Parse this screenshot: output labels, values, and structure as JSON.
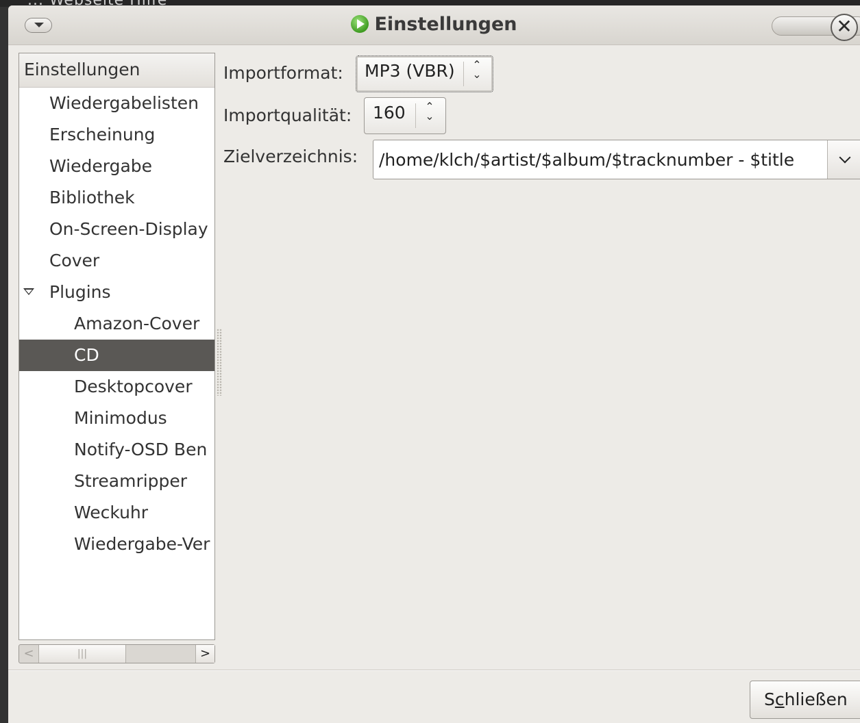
{
  "background": {
    "title_fragment": "... Webseite Hilfe"
  },
  "window": {
    "title": "Einstellungen",
    "close_glyph": "✕",
    "accent_color": "#5a5855"
  },
  "sidebar": {
    "header": "Einstellungen",
    "items": [
      {
        "label": "Wiedergabelisten",
        "level": 1
      },
      {
        "label": "Erscheinung",
        "level": 1
      },
      {
        "label": "Wiedergabe",
        "level": 1
      },
      {
        "label": "Bibliothek",
        "level": 1
      },
      {
        "label": "On-Screen-Display",
        "level": 1
      },
      {
        "label": "Cover",
        "level": 1
      },
      {
        "label": "Plugins",
        "level": 1,
        "expanded": true
      },
      {
        "label": "Amazon-Cover",
        "level": 2
      },
      {
        "label": "CD",
        "level": 2,
        "selected": true
      },
      {
        "label": "Desktopcover",
        "level": 2
      },
      {
        "label": "Minimodus",
        "level": 2
      },
      {
        "label": "Notify-OSD Ben",
        "level": 2
      },
      {
        "label": "Streamripper",
        "level": 2
      },
      {
        "label": "Weckuhr",
        "level": 2
      },
      {
        "label": "Wiedergabe-Ver",
        "level": 2
      }
    ],
    "scrollbar": {
      "left_arrow": "<",
      "thumb_grip": "|||",
      "right_arrow": ">"
    }
  },
  "form": {
    "import_format": {
      "label": "Importformat:",
      "value": "MP3 (VBR)"
    },
    "import_quality": {
      "label": "Importqualität:",
      "value": "160"
    },
    "target_dir": {
      "label": "Zielverzeichnis:",
      "value": "/home/klch/$artist/$album/$tracknumber - $title"
    }
  },
  "footer": {
    "close_label_prefix": "S",
    "close_label_mnemonic": "c",
    "close_label_rest": "hließen"
  },
  "icons": {
    "menu": "chevron-down-icon",
    "app": "play-icon",
    "close": "close-icon",
    "expander": "triangle-down-icon",
    "updown": "updown-arrows-icon",
    "dropdown": "chevron-down-icon"
  }
}
